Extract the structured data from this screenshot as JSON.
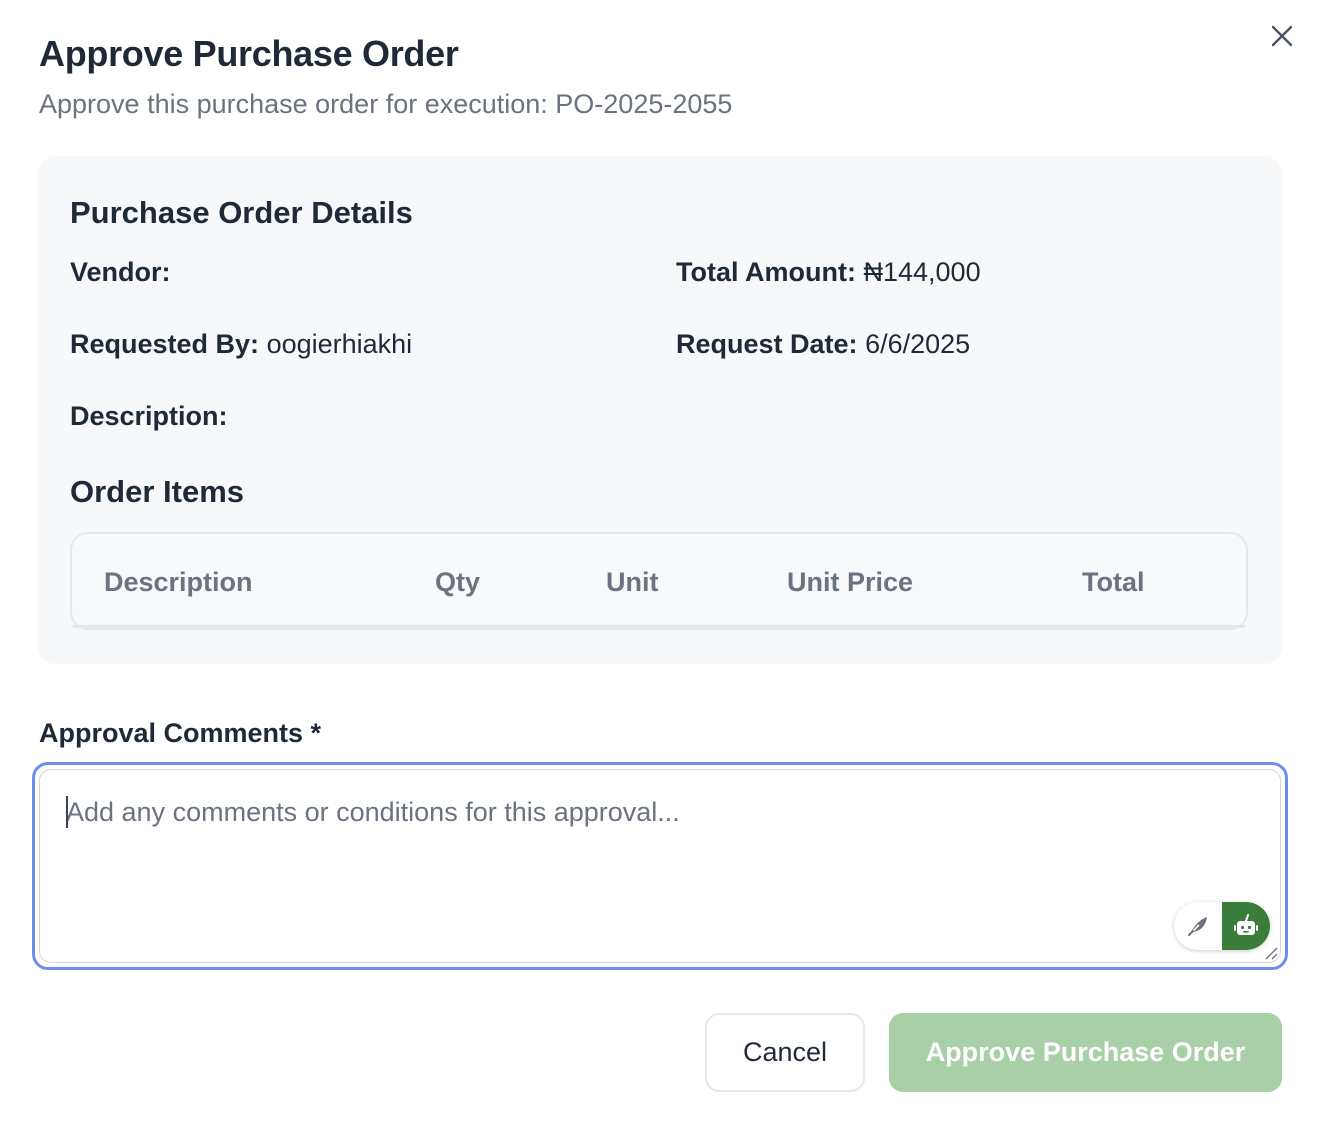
{
  "dialog": {
    "title": "Approve Purchase Order",
    "subtitle": "Approve this purchase order for execution: PO-2025-2055",
    "close_icon": "close-icon"
  },
  "details": {
    "section_title": "Purchase Order Details",
    "vendor_label": "Vendor:",
    "vendor_value": "",
    "total_amount_label": "Total Amount:",
    "total_amount_value": "₦144,000",
    "requested_by_label": "Requested By:",
    "requested_by_value": "oogierhiakhi",
    "request_date_label": "Request Date:",
    "request_date_value": "6/6/2025",
    "description_label": "Description:",
    "description_value": ""
  },
  "order_items": {
    "section_title": "Order Items",
    "columns": [
      "Description",
      "Qty",
      "Unit",
      "Unit Price",
      "Total"
    ],
    "rows": []
  },
  "comments": {
    "label": "Approval Comments *",
    "value": "",
    "placeholder": "Add any comments or conditions for this approval...",
    "assist_icons": [
      "feather-icon",
      "robot-icon"
    ]
  },
  "actions": {
    "cancel_label": "Cancel",
    "approve_label": "Approve Purchase Order",
    "approve_color": "#a9cfa7",
    "focus_color": "#6b8ef0"
  }
}
